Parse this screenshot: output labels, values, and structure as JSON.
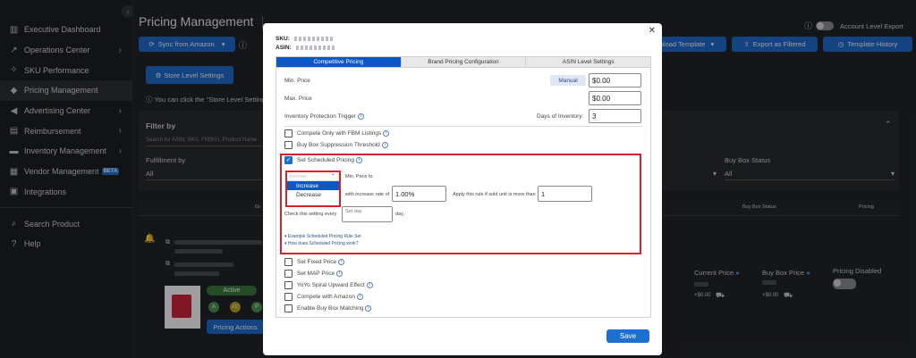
{
  "sidebar": {
    "items": [
      {
        "label": "Executive Dashboard",
        "icon": "bar-chart-icon",
        "chevron": false
      },
      {
        "label": "Operations Center",
        "icon": "trend-icon",
        "chevron": true
      },
      {
        "label": "SKU Performance",
        "icon": "sparkle-icon",
        "chevron": false
      },
      {
        "label": "Pricing Management",
        "icon": "tag-icon",
        "chevron": false,
        "active": true
      },
      {
        "label": "Advertising Center",
        "icon": "megaphone-icon",
        "chevron": true
      },
      {
        "label": "Reimbursement",
        "icon": "receipt-icon",
        "chevron": true
      },
      {
        "label": "Inventory Management",
        "icon": "truck-icon",
        "chevron": true
      },
      {
        "label": "Vendor Management",
        "icon": "store-icon",
        "chevron": false,
        "badge": "BETA"
      },
      {
        "label": "Integrations",
        "icon": "plug-icon",
        "chevron": false
      }
    ],
    "footer": [
      {
        "label": "Search Product",
        "icon": "search-icon"
      },
      {
        "label": "Help",
        "icon": "help-icon"
      }
    ]
  },
  "header": {
    "title": "Pricing Management",
    "sync_label": "Sync from Amazon",
    "upload_label": "pload Template",
    "export_label": "Export as Filtered",
    "history_label": "Template History",
    "account_export_label": "Account Level Export",
    "store_level_label": "Store Level Settings",
    "notice": "You can click the \"Store Level Setting"
  },
  "filters": {
    "title": "Filter by",
    "search_placeholder": "Search for ASIN, SKU, FNSKU, Product Name",
    "fulfillment_label": "Fulfillment by",
    "fulfillment_value": "All",
    "all_value": "All",
    "buybox_label": "Buy Box Status",
    "buybox_value": "All"
  },
  "table": {
    "col_buybox_status": "Buy Box Status",
    "col_pricing": "Pricing",
    "col_pricing_short": "Pri"
  },
  "row": {
    "status_badge": "Active",
    "actions_label": "Pricing Actions",
    "current_price_label": "Current Price",
    "current_price_delta": "+$0.00",
    "buybox_price_label": "Buy Box Price",
    "buybox_price_delta": "+$0.00",
    "pricing_disabled_label": "Pricing Disabled",
    "tags": [
      "A",
      "FC",
      "P"
    ]
  },
  "modal": {
    "sku_label": "SKU:",
    "asin_label": "ASIN:",
    "tabs": [
      "Competitive Pricing",
      "Brand Pricing Configuration",
      "ASIN Level Settings"
    ],
    "min_price_label": "Min. Price",
    "manual_badge": "Manual",
    "min_price_value": "$0.00",
    "max_price_label": "Max. Price",
    "max_price_value": "$0.00",
    "inventory_protection_label": "Inventory Protection Trigger",
    "days_inventory_label": "Days of Inventory:",
    "days_inventory_value": "3",
    "checkboxes": {
      "fbm": "Compete Only with FBM Listings",
      "bbs": "Buy Box Suppression Threshold",
      "scheduled": "Set Scheduled Pricing",
      "fixed": "Set Fixed Price",
      "map": "Set MAP Price",
      "yoyo": "YoYo Spiral Upward Effect",
      "amazon": "Compete with Amazon",
      "bbm": "Enable Buy Box Matching"
    },
    "scheduled": {
      "dropdown_placeholder": "Increase",
      "options": [
        "Increase",
        "Decrease"
      ],
      "min_price_to": "Min. Price to",
      "increase_rate_label": "with increase rate of",
      "increase_rate_value": "1.00%",
      "rule_label": "Apply this rule if sold unit is more than",
      "rule_value": "1",
      "every_label": "Check this setting every",
      "day_placeholder": "Set day",
      "day_suffix": "day.",
      "example_link": "Example Scheduled Pricing Rule Set",
      "how_link": "How does Scheduled Pricing work?"
    },
    "save_label": "Save",
    "close_icon": "close-icon"
  },
  "colors": {
    "accent": "#1f6fd1",
    "tab_active": "#0b57c4",
    "highlight": "#d7222c"
  }
}
